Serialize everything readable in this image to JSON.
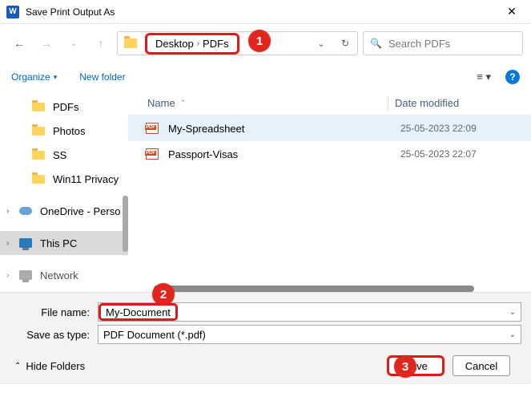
{
  "window": {
    "title": "Save Print Output As"
  },
  "breadcrumb": {
    "seg1": "Desktop",
    "seg2": "PDFs"
  },
  "search": {
    "placeholder": "Search PDFs"
  },
  "toolbar": {
    "organize": "Organize",
    "newfolder": "New folder"
  },
  "nav": {
    "items": [
      {
        "label": "PDFs"
      },
      {
        "label": "Photos"
      },
      {
        "label": "SS"
      },
      {
        "label": "Win11 Privacy"
      }
    ],
    "onedrive": "OneDrive - Perso",
    "thispc": "This PC",
    "network": "Network"
  },
  "columns": {
    "name": "Name",
    "date": "Date modified"
  },
  "files": [
    {
      "name": "My-Spreadsheet",
      "date": "25-05-2023 22:09"
    },
    {
      "name": "Passport-Visas",
      "date": "25-05-2023 22:07"
    }
  ],
  "form": {
    "filename_label": "File name:",
    "filename_value": "My-Document",
    "type_label": "Save as type:",
    "type_value": "PDF Document (*.pdf)"
  },
  "footer": {
    "hide": "Hide Folders",
    "save": "Save",
    "cancel": "Cancel"
  },
  "steps": {
    "one": "1",
    "two": "2",
    "three": "3"
  }
}
